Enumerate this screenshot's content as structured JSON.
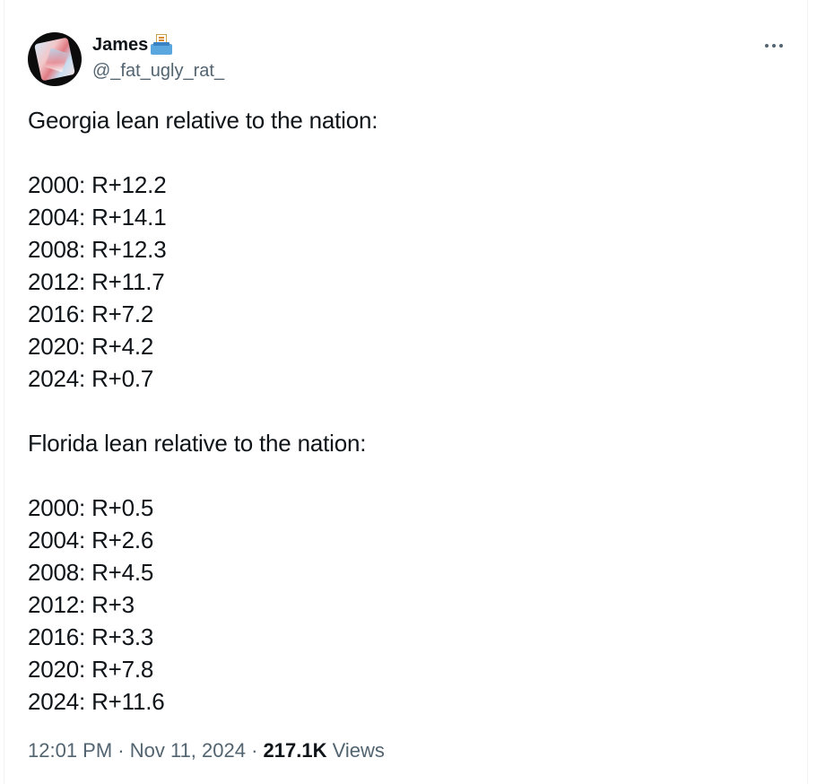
{
  "author": {
    "display_name": "James",
    "handle": "@_fat_ugly_rat_",
    "name_emoji_icon": "ballot-box-icon",
    "avatar_icon": "avatar-image"
  },
  "post": {
    "intro_georgia": "Georgia lean relative to the nation:",
    "georgia": [
      "2000: R+12.2",
      "2004: R+14.1",
      "2008: R+12.3",
      "2012: R+11.7",
      "2016: R+7.2",
      "2020: R+4.2",
      "2024: R+0.7"
    ],
    "intro_florida": "Florida lean relative to the nation:",
    "florida": [
      "2000: R+0.5",
      "2004: R+2.6",
      "2008: R+4.5",
      "2012: R+3",
      "2016: R+3.3",
      "2020: R+7.8",
      "2024: R+11.6"
    ]
  },
  "meta": {
    "time": "12:01 PM",
    "separator": " · ",
    "date": "Nov 11, 2024",
    "views_count": "217.1K",
    "views_label": " Views"
  },
  "menu": {
    "more_icon": "more-options-icon"
  },
  "colors": {
    "text_primary": "#0f1419",
    "text_secondary": "#536471",
    "border": "#eff3f4"
  }
}
